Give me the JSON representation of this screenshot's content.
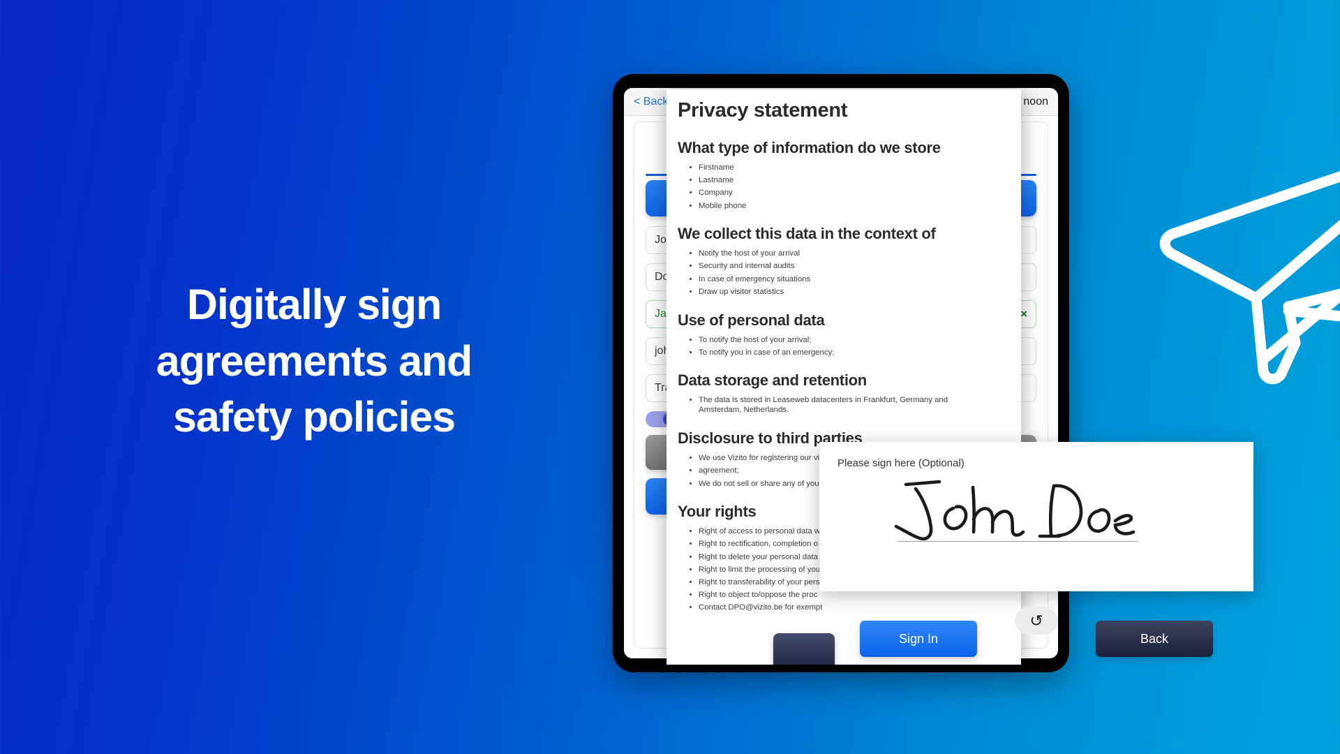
{
  "hero": {
    "headline_lines": [
      "Digitally sign",
      "agreements and",
      "safety policies"
    ]
  },
  "colors": {
    "bg_gradient_start": "#0a27c4",
    "bg_gradient_end": "#00a3dd",
    "primary_blue": "#1060d8",
    "dark_navy": "#1d2240",
    "valid_green": "#1f8a2e"
  },
  "icons": {
    "paper_plane": "paper-plane-icon",
    "undo": "↺",
    "clear": "×",
    "back_chevron": "<"
  },
  "tablet": {
    "appbar": {
      "back_label": "< Back",
      "greeting": "noon"
    },
    "form": {
      "fields": [
        {
          "value": "John"
        },
        {
          "value": "Doe"
        },
        {
          "value": "Jane",
          "valid": true,
          "clear": "×"
        },
        {
          "value": "john."
        },
        {
          "value": "Trans"
        }
      ]
    }
  },
  "privacy": {
    "title": "Privacy statement",
    "sections": [
      {
        "heading": "What type of information do we store",
        "items": [
          "Firstname",
          "Lastname",
          "Company",
          "Mobile phone"
        ]
      },
      {
        "heading": "We collect this data in the context of",
        "items": [
          "Notify the host of your arrival",
          "Security and internal audits",
          "In case of emergency situations",
          "Draw up visitor statistics"
        ]
      },
      {
        "heading": "Use of personal data",
        "items": [
          "To notify the host of your arrival;",
          "To notify you in case of an emergency;"
        ]
      },
      {
        "heading": "Data storage and retention",
        "items": [
          "The data is stored in Leaseweb datacenters in Frankfurt, Germany and Amsterdam, Netherlands."
        ],
        "wrap": true
      },
      {
        "heading": "Disclosure to third parties",
        "items": [
          "We use Vizito for registering our vis",
          "agreement;",
          "We do not sell or share any of your"
        ]
      },
      {
        "heading": "Your rights",
        "items": [
          "Right of access to personal data w",
          "Right to rectification, completion o",
          "Right to delete your personal data",
          "Right to limit the processing of you",
          "Right to transferability of your pers",
          "Right to object to/oppose the proc",
          "Contact DPO@vizito.be for exempt"
        ]
      }
    ]
  },
  "signature": {
    "label": "Please sign here (Optional)",
    "signature_text": "John Doe",
    "sign_in_label": "Sign In",
    "back_label": "Back",
    "undo_label": "↺"
  }
}
